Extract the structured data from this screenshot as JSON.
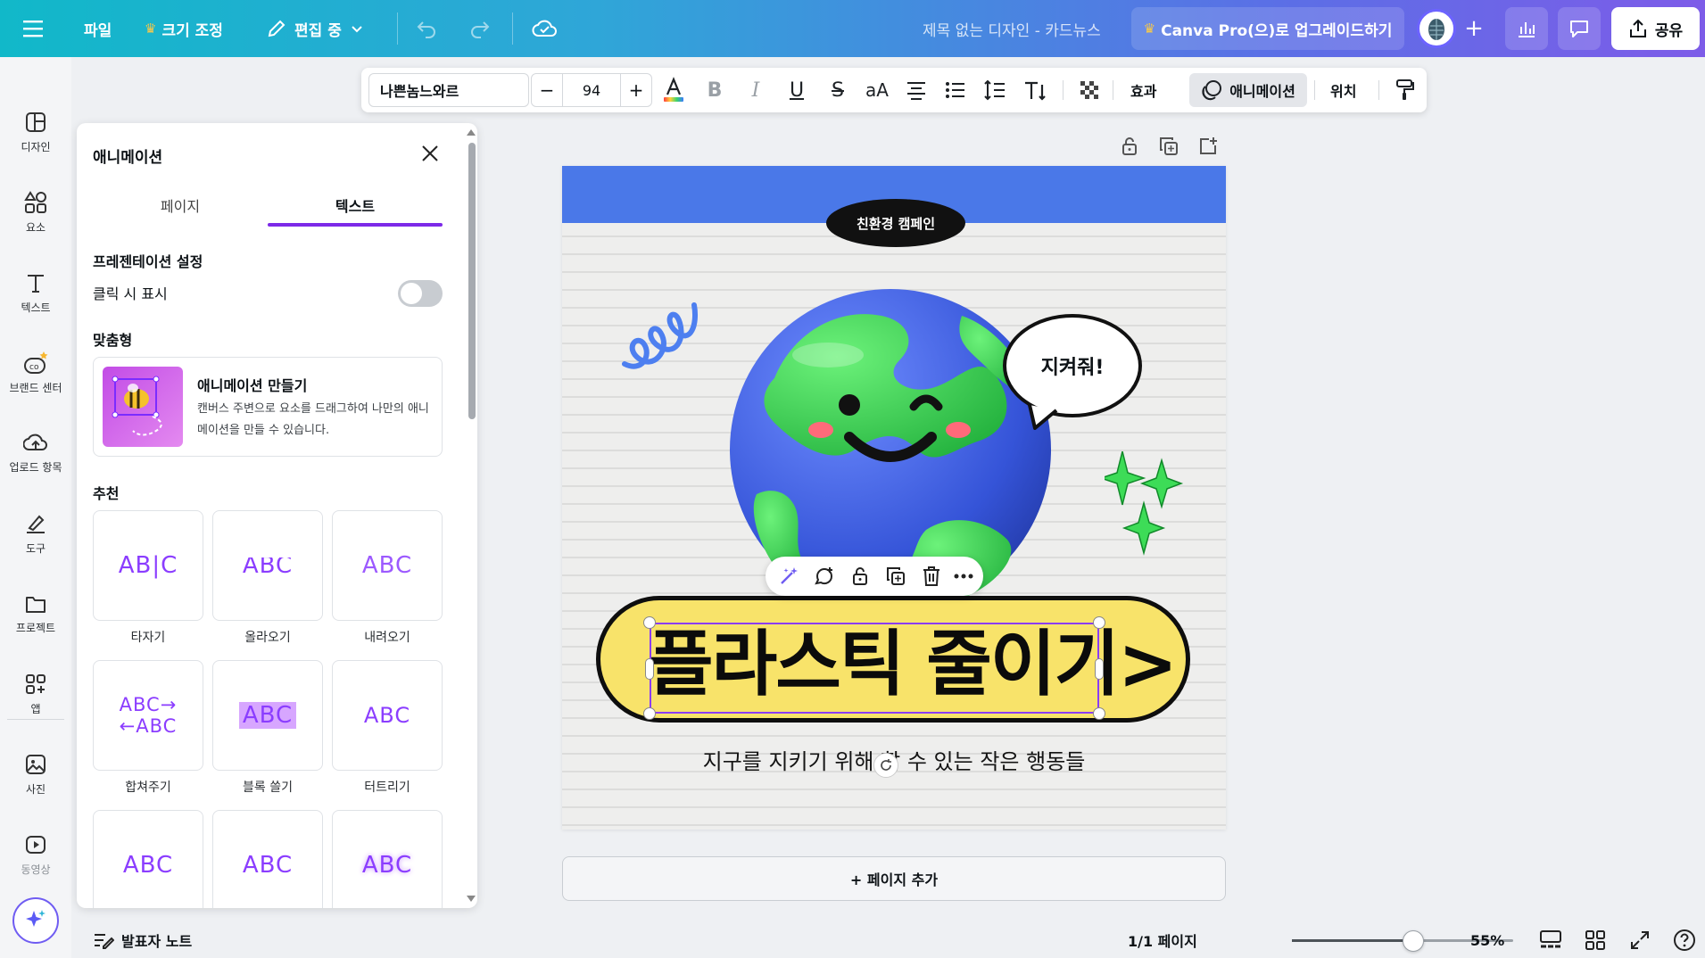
{
  "topbar": {
    "menu_icon": "hamburger-icon",
    "file_label": "파일",
    "resize_label": "크기 조정",
    "editing_label": "편집 중",
    "title": "제목 없는 디자인 - 카드뉴스",
    "upgrade_label": "Canva Pro(으)로 업그레이드하기",
    "share_label": "공유"
  },
  "rail": {
    "items": [
      {
        "label": "디자인",
        "icon": "layout-icon"
      },
      {
        "label": "요소",
        "icon": "shapes-icon"
      },
      {
        "label": "텍스트",
        "icon": "text-icon"
      },
      {
        "label": "브랜드 센터",
        "icon": "brand-icon"
      },
      {
        "label": "업로드 항목",
        "icon": "upload-cloud-icon"
      },
      {
        "label": "도구",
        "icon": "pen-tool-icon"
      },
      {
        "label": "프로젝트",
        "icon": "folder-icon"
      },
      {
        "label": "앱",
        "icon": "apps-grid-icon"
      },
      {
        "label": "사진",
        "icon": "photo-icon"
      },
      {
        "label": "동영상",
        "icon": "video-icon"
      }
    ]
  },
  "panel": {
    "title": "애니메이션",
    "tabs": [
      {
        "label": "페이지"
      },
      {
        "label": "텍스트"
      }
    ],
    "presentation_title": "프레젠테이션 설정",
    "click_label": "클릭 시 표시",
    "custom_title": "맞춤형",
    "custom_card": {
      "heading": "애니메이션 만들기",
      "description": "캔버스 주변으로 요소를 드래그하여 나만의 애니메이션을 만들 수 있습니다."
    },
    "recommended_title": "추천",
    "animations": [
      {
        "label": "타자기",
        "glyph": "AB|C"
      },
      {
        "label": "올라오기",
        "glyph": "ABC"
      },
      {
        "label": "내려오기",
        "glyph": "ABC"
      },
      {
        "label": "합쳐주기",
        "glyph": "ABC→ ←ABC"
      },
      {
        "label": "블록 쓸기",
        "glyph": "ABC"
      },
      {
        "label": "터트리기",
        "glyph": "ABC"
      },
      {
        "label": "",
        "glyph": "ABC"
      },
      {
        "label": "",
        "glyph": "ABC"
      },
      {
        "label": "",
        "glyph": "ABC"
      }
    ]
  },
  "toolbar": {
    "font": "나쁜놈느와르",
    "size": "94",
    "minus": "−",
    "plus": "+",
    "effects_label": "효과",
    "animation_label": "애니메이션",
    "position_label": "위치"
  },
  "canvas": {
    "campaign_label": "친환경 캠페인",
    "headline": "플라스틱 줄이기>",
    "subhead": "지구를 지키기 위해 할 수 있는 작은 행동들",
    "speech": "지켜줘!",
    "colors": {
      "band": "#4a78e8",
      "headline_fill": "#f8e36a",
      "accent": "#8b3dff",
      "sparkle": "#3ddc57"
    }
  },
  "add_page_label": "+ 페이지 추가",
  "bottombar": {
    "notes_label": "발표자 노트",
    "page_indicator": "1/1 페이지",
    "zoom": "55%",
    "zoom_value": 0.55
  }
}
